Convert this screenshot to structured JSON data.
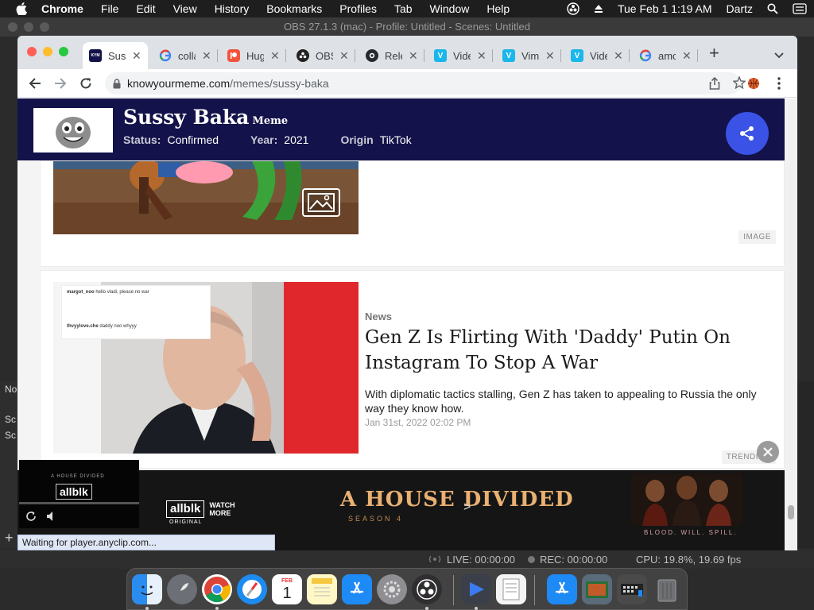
{
  "menubar": {
    "app": "Chrome",
    "items": [
      "File",
      "Edit",
      "View",
      "History",
      "Bookmarks",
      "Profiles",
      "Tab",
      "Window",
      "Help"
    ],
    "clock": "Tue Feb 1  1:19 AM",
    "user": "Dartz"
  },
  "obs": {
    "title": "OBS 27.1.3 (mac) - Profile: Untitled - Scenes: Untitled",
    "left_labels": [
      "No",
      "Sc",
      "Sc"
    ],
    "live": "LIVE: 00:00:00",
    "rec": "REC: 00:00:00",
    "cpu": "CPU: 19.8%, 19.69 fps"
  },
  "tabs": [
    {
      "label": "Sussy Baka",
      "favicon": "kym-icon",
      "color": "#13124a",
      "active": true
    },
    {
      "label": "collage",
      "favicon": "google-icon",
      "color": "#4285f4"
    },
    {
      "label": "Hugging",
      "favicon": "patreon-icon",
      "color": "#f2533a"
    },
    {
      "label": "OBS",
      "favicon": "obs-icon",
      "color": "#222222"
    },
    {
      "label": "Releases",
      "favicon": "github-icon",
      "color": "#24292e"
    },
    {
      "label": "Video",
      "favicon": "vimeo-icon",
      "color": "#1ab7ea"
    },
    {
      "label": "Vimeo",
      "favicon": "vimeo-icon",
      "color": "#1ab7ea"
    },
    {
      "label": "Video",
      "favicon": "vimeo-icon",
      "color": "#1ab7ea"
    },
    {
      "label": "among",
      "favicon": "google-icon",
      "color": "#4285f4"
    }
  ],
  "address": {
    "domain": "knowyourmeme.com",
    "path": "/memes/sussy-baka"
  },
  "meme": {
    "title": "Sussy Baka",
    "kind": "Meme",
    "status_label": "Status:",
    "status": "Confirmed",
    "year_label": "Year:",
    "year": "2021",
    "origin_label": "Origin",
    "origin": "TikTok"
  },
  "cards": {
    "image_label": "IMAGE",
    "news": {
      "category": "News",
      "title": "Gen Z Is Flirting With 'Daddy' Putin On Instagram To Stop A War",
      "description": "With diplomatic tactics stalling, Gen Z has taken to appealing to Russia the only way they know how.",
      "date": "Jan 31st, 2022 02:02 PM",
      "label": "TRENDING",
      "comment1_user": "margot_noo",
      "comment1_text": "hello vladi, please no war",
      "comment2_user": "thvyylove.che",
      "comment2_text": "daddy noo whyyy"
    }
  },
  "ad": {
    "brand": "allblk",
    "brand_sub": "ORIGINAL",
    "cta": "WATCH MORE",
    "title": "A HOUSE DIVIDED",
    "season": "SEASON 4",
    "tagline": "BLOOD. WILL. SPILL."
  },
  "player": {
    "brand": "allblk",
    "header": "A HOUSE DIVIDED"
  },
  "status_bubble": "Waiting for player.anyclip.com...",
  "dock": {
    "calendar_month": "FEB",
    "calendar_day": "1"
  }
}
